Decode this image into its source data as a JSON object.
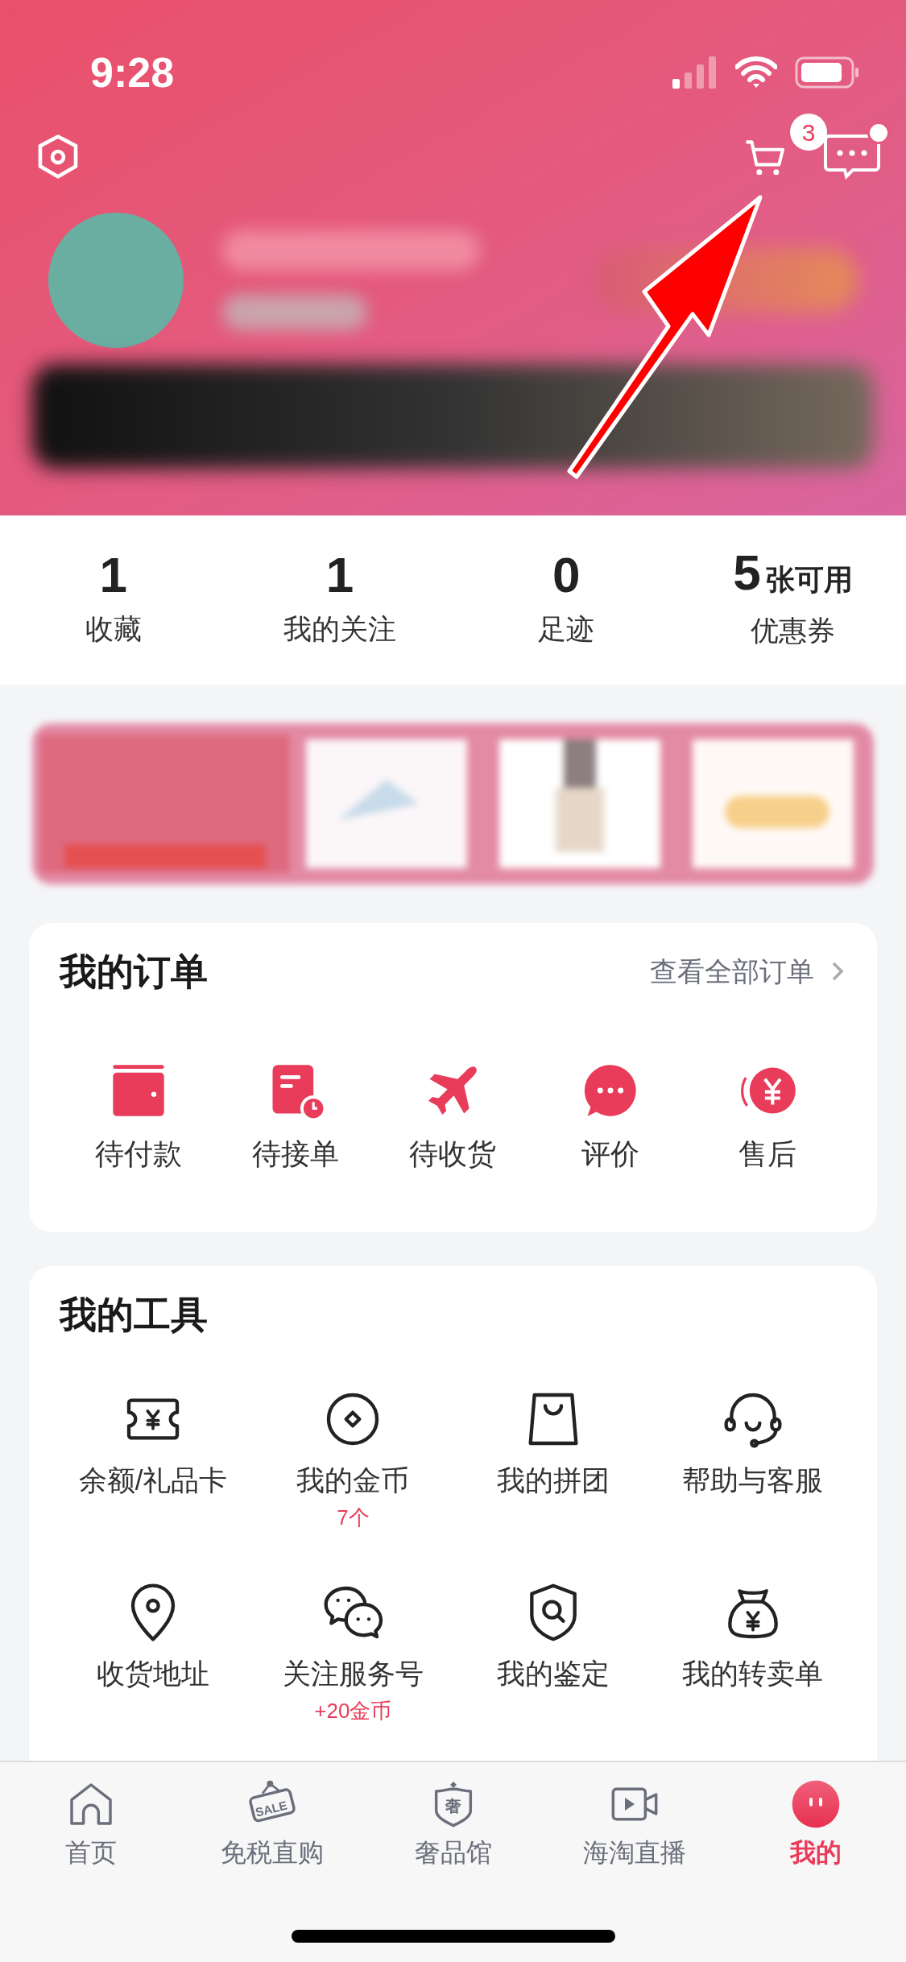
{
  "status_bar": {
    "time": "9:28"
  },
  "header": {
    "cart_badge": "3",
    "messages_unread": true
  },
  "stats": [
    {
      "value": "1",
      "label": "收藏"
    },
    {
      "value": "1",
      "label": "我的关注"
    },
    {
      "value": "0",
      "label": "足迹"
    },
    {
      "value": "5",
      "suffix": "张可用",
      "label": "优惠券"
    }
  ],
  "orders": {
    "title": "我的订单",
    "link": "查看全部订单",
    "items": [
      {
        "kind": "wallet",
        "label": "待付款"
      },
      {
        "kind": "receipt",
        "label": "待接单"
      },
      {
        "kind": "plane",
        "label": "待收货"
      },
      {
        "kind": "chat",
        "label": "评价"
      },
      {
        "kind": "refund",
        "label": "售后"
      }
    ]
  },
  "tools": {
    "title": "我的工具",
    "items": [
      {
        "kind": "ticket",
        "label": "余额/礼品卡"
      },
      {
        "kind": "coin",
        "label": "我的金币",
        "note": "7个"
      },
      {
        "kind": "bag",
        "label": "我的拼团"
      },
      {
        "kind": "headset",
        "label": "帮助与客服"
      },
      {
        "kind": "pin",
        "label": "收货地址"
      },
      {
        "kind": "wechat",
        "label": "关注服务号",
        "note": "+20金币"
      },
      {
        "kind": "shield",
        "label": "我的鉴定"
      },
      {
        "kind": "moneybag",
        "label": "我的转卖单"
      }
    ]
  },
  "tab_bar": [
    {
      "kind": "home",
      "label": "首页",
      "selected": false
    },
    {
      "kind": "sale",
      "label": "免税直购",
      "icon_text": "SALE",
      "selected": false
    },
    {
      "kind": "luxury",
      "label": "奢品馆",
      "icon_text": "奢",
      "selected": false
    },
    {
      "kind": "live",
      "label": "海淘直播",
      "selected": false
    },
    {
      "kind": "me",
      "label": "我的",
      "selected": true
    }
  ]
}
